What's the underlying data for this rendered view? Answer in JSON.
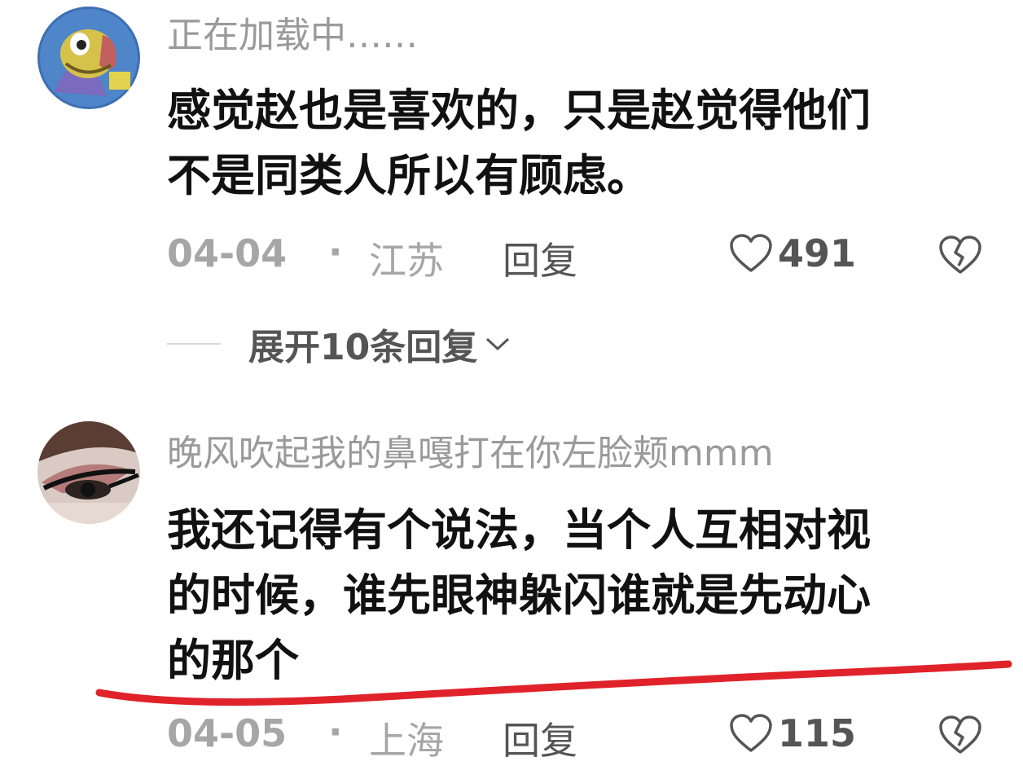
{
  "comments": [
    {
      "username": "正在加载中……",
      "text_line1": "感觉赵也是喜欢的，只是赵觉得他们",
      "text_line2": "不是同类人所以有顾虑。",
      "date": "04-04",
      "separator": "·",
      "location": "江苏",
      "reply_label": "回复",
      "likes": "491",
      "expand_label": "展开10条回复"
    },
    {
      "username": "晚风吹起我的鼻嘎打在你左脸颊mmm",
      "text_line1": "我还记得有个说法，当个人互相对视",
      "text_line2": "的时候，谁先眼神躲闪谁就是先动心",
      "text_line3": "的那个",
      "date": "04-05",
      "separator": "·",
      "location": "上海",
      "reply_label": "回复",
      "likes": "115"
    }
  ],
  "icons": {
    "like": "heart-outline-icon",
    "dislike": "broken-heart-icon",
    "expand": "chevron-down-icon"
  },
  "colors": {
    "underline": "#e0222b",
    "username": "#9a9a9a",
    "meta": "#a6a6a6"
  }
}
